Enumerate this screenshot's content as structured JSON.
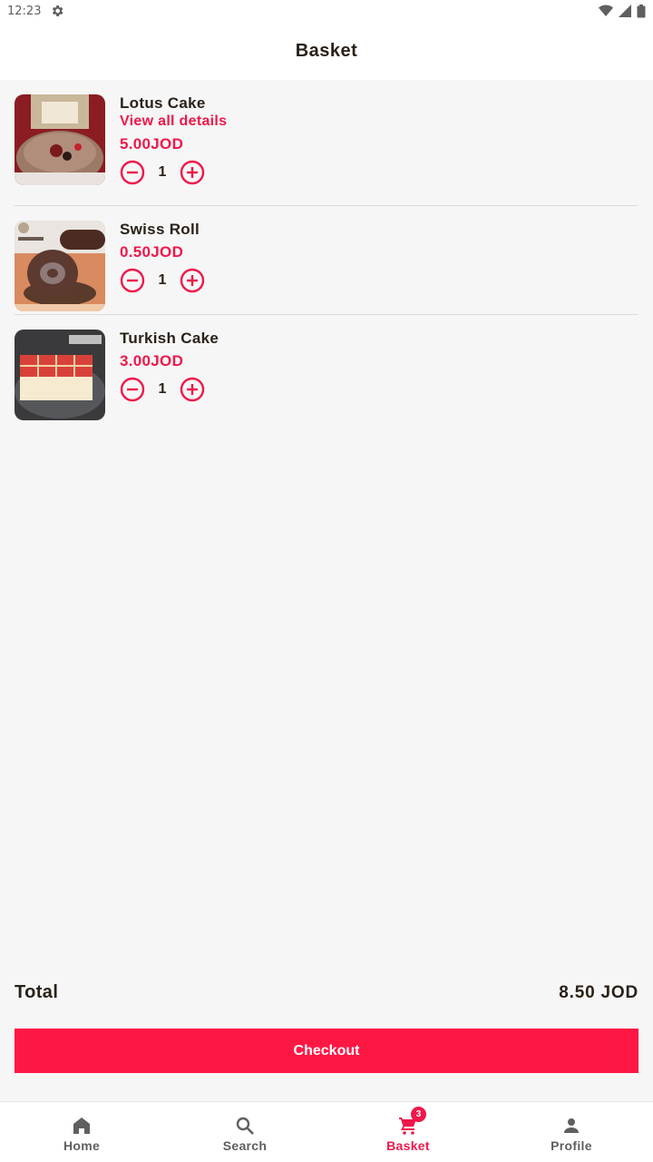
{
  "status_bar": {
    "time": "12:23",
    "icons": [
      "gear-icon",
      "wifi-icon",
      "signal-icon",
      "battery-icon"
    ]
  },
  "app_bar": {
    "title": "Basket"
  },
  "colors": {
    "accent": "#f0174a",
    "checkout": "#ff1744",
    "text": "#2a2118",
    "background": "#f6f6f6"
  },
  "basket": {
    "items": [
      {
        "name": "Lotus Cake",
        "details_link": "View all details",
        "price": "5.00JOD",
        "quantity": "1"
      },
      {
        "name": "Swiss Roll",
        "price": "0.50JOD",
        "quantity": "1"
      },
      {
        "name": "Turkish Cake",
        "price": "3.00JOD",
        "quantity": "1"
      }
    ]
  },
  "summary": {
    "total_label": "Total",
    "total_value": "8.50 JOD",
    "checkout_label": "Checkout"
  },
  "bottom_nav": {
    "items": [
      {
        "label": "Home",
        "icon": "home-icon"
      },
      {
        "label": "Search",
        "icon": "search-icon"
      },
      {
        "label": "Basket",
        "icon": "cart-icon",
        "badge": "3",
        "active": true
      },
      {
        "label": "Profile",
        "icon": "person-icon"
      }
    ]
  }
}
